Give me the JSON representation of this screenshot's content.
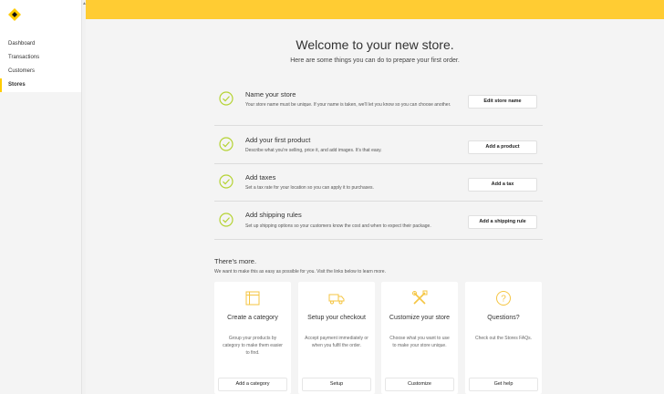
{
  "sidebar": {
    "items": [
      {
        "label": "Dashboard"
      },
      {
        "label": "Transactions"
      },
      {
        "label": "Customers"
      },
      {
        "label": "Stores"
      }
    ],
    "active_item": "Stores"
  },
  "colors": {
    "accent": "#ffcc33",
    "check": "#b5d334",
    "icon_yellow": "#f5c542"
  },
  "header": {
    "title": "Welcome to your new store.",
    "subtitle": "Here are some things you can do to prepare your first order."
  },
  "tasks": [
    {
      "title": "Name your store",
      "desc": "Your store name must be unique. If your name is taken, we'll let you know so you can choose another.",
      "button": "Edit store name",
      "icon": "check-circle-icon"
    },
    {
      "title": "Add your first product",
      "desc": "Describe what you're selling, price it, and add images. It's that easy.",
      "button": "Add a product",
      "icon": "check-circle-icon"
    },
    {
      "title": "Add taxes",
      "desc": "Set a tax rate for your location so you can apply it to purchases.",
      "button": "Add a tax",
      "icon": "check-circle-icon"
    },
    {
      "title": "Add shipping rules",
      "desc": "Set up shipping options so your customers know the cost and when to expect their package.",
      "button": "Add a shipping rule",
      "icon": "check-circle-icon"
    }
  ],
  "more": {
    "title": "There's more.",
    "desc": "We want to make this as easy as possible for you. Visit the links below to learn more."
  },
  "cards": [
    {
      "title": "Create a category",
      "desc": "Group your products by category to make them easier to find.",
      "button": "Add a category",
      "icon": "folder-icon"
    },
    {
      "title": "Setup your checkout",
      "desc": "Accept payment immediately or when you fulfil the order.",
      "button": "Setup",
      "icon": "truck-icon"
    },
    {
      "title": "Customize your store",
      "desc": "Choose what you want to use to make your store unique.",
      "button": "Customize",
      "icon": "tools-icon"
    },
    {
      "title": "Questions?",
      "desc": "Check out the Stores FAQs.",
      "button": "Get help",
      "icon": "question-icon"
    }
  ]
}
